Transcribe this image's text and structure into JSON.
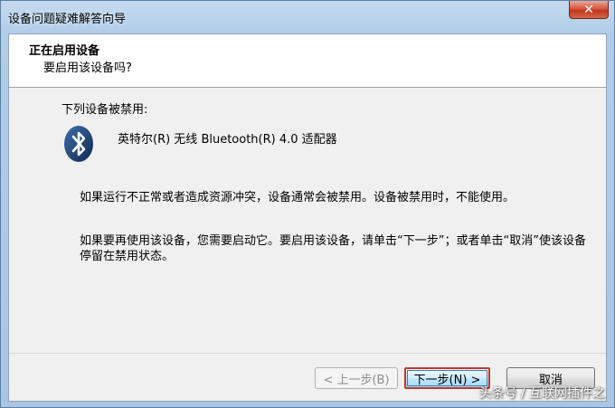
{
  "window": {
    "title": "设备问题疑难解答向导",
    "close_glyph": "✕"
  },
  "header": {
    "title": "正在启用设备",
    "subtitle": "要启用该设备吗?"
  },
  "body": {
    "intro": "下列设备被禁用:",
    "device_icon": "bluetooth-icon",
    "device_name": "英特尔(R) 无线 Bluetooth(R) 4.0 适配器",
    "paragraph1": "如果运行不正常或者造成资源冲突，设备通常会被禁用。设备被禁用时，不能使用。",
    "paragraph2": "如果要再使用该设备，您需要启动它。要启用该设备，请单击“下一步”；或者单击“取消”使该设备停留在禁用状态。"
  },
  "buttons": {
    "back": "< 上一步(B)",
    "next": "下一步(N) >",
    "cancel": "取消"
  },
  "watermark": "头条号 / 互联网插件之",
  "colors": {
    "bluetooth_bg": "#1a3f6f",
    "highlight_border": "#c0392b"
  }
}
